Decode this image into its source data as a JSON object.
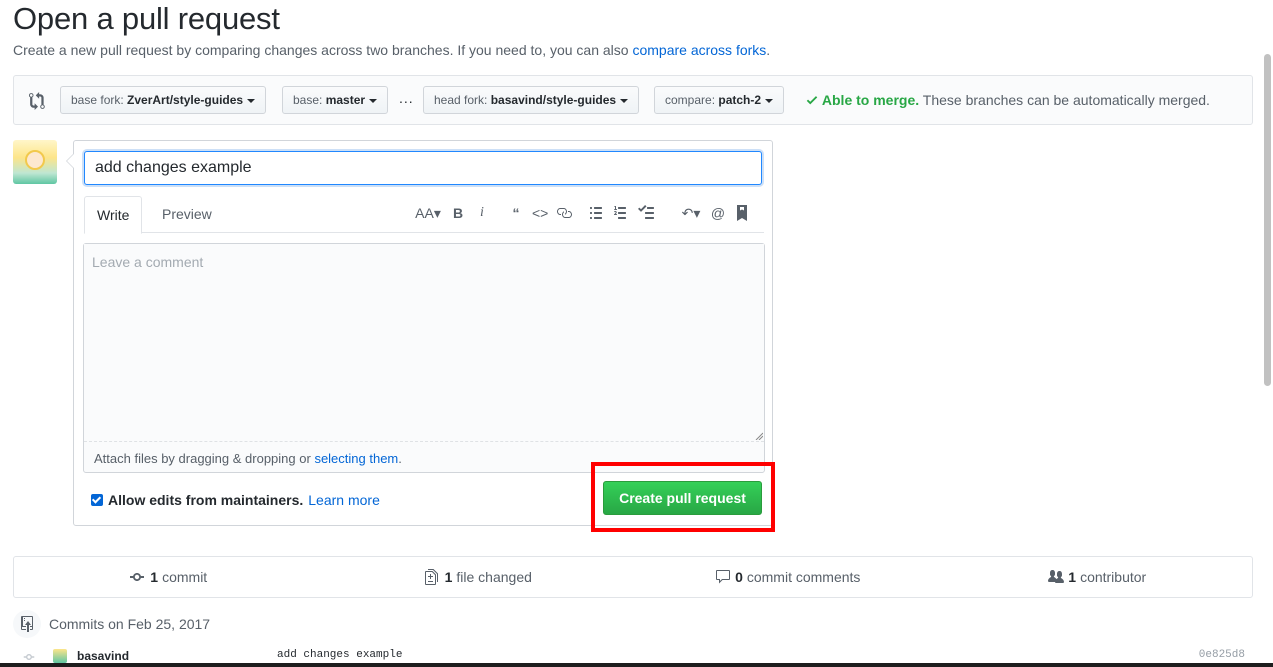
{
  "page": {
    "title": "Open a pull request",
    "subtitle": "Create a new pull request by comparing changes across two branches. If you need to, you can also",
    "subtitle_link": "compare across forks",
    "subtitle_end": "."
  },
  "range": {
    "base_fork_label": "base fork:",
    "base_fork_value": "ZverArt/style-guides",
    "base_label": "base:",
    "base_value": "master",
    "dots": "...",
    "head_fork_label": "head fork:",
    "head_fork_value": "basavind/style-guides",
    "compare_label": "compare:",
    "compare_value": "patch-2",
    "merge_ok": "Able to merge.",
    "merge_text": "These branches can be automatically merged."
  },
  "form": {
    "title_value": "add changes example",
    "tab_write": "Write",
    "tab_preview": "Preview",
    "comment_placeholder": "Leave a comment",
    "attach_text": "Attach files by dragging & dropping or",
    "attach_link": "selecting them",
    "attach_end": ".",
    "allow_edits_label": "Allow edits from maintainers.",
    "allow_edits_checked": true,
    "learn_more": "Learn more",
    "create_button": "Create pull request"
  },
  "summary": {
    "commits_count": "1",
    "commits_label": "commit",
    "files_count": "1",
    "files_label": "file changed",
    "comments_count": "0",
    "comments_label": "commit comments",
    "contributors_count": "1",
    "contributors_label": "contributor"
  },
  "commits": {
    "date_heading": "Commits on Feb 25, 2017",
    "rows": [
      {
        "author": "basavind",
        "message": "add changes example",
        "sha": "0e825d8"
      }
    ]
  },
  "colors": {
    "link": "#0366d6",
    "success": "#28a745",
    "highlight": "#ff0000"
  }
}
